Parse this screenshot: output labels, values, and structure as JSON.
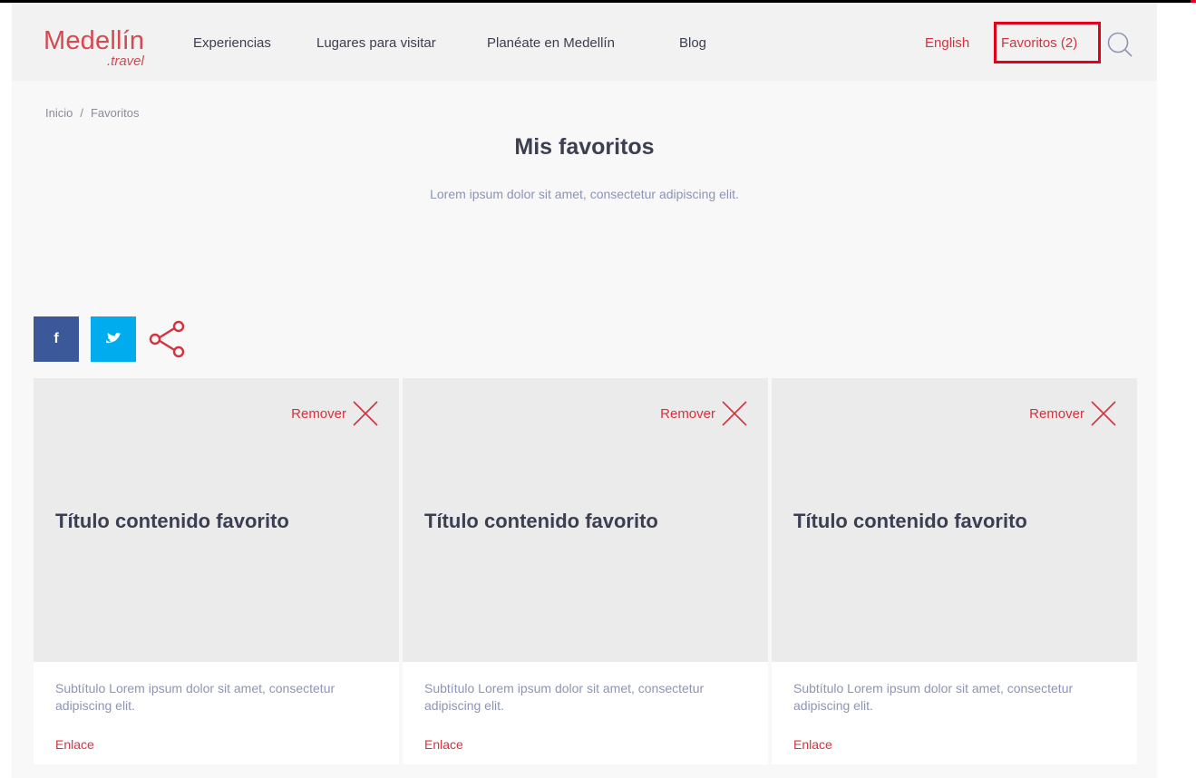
{
  "header": {
    "logo_main": "Medellín",
    "logo_sub": ".travel",
    "nav": [
      "Experiencias",
      "Lugares para visitar",
      "Planéate en Medellín",
      "Blog"
    ],
    "language_label": "English",
    "favorites_label": "Favoritos (2)",
    "search_icon": "search-icon"
  },
  "breadcrumb": {
    "home": "Inicio",
    "separator": "/",
    "current": "Favoritos"
  },
  "page": {
    "title": "Mis favoritos",
    "subtitle": "Lorem ipsum dolor sit amet, consectetur adipiscing elit."
  },
  "social": {
    "facebook_label": "f",
    "icons": [
      "facebook-icon",
      "twitter-icon",
      "share-icon"
    ]
  },
  "cards": [
    {
      "remove_label": "Remover",
      "title": "Título contenido favorito",
      "subtitle": "Subtítulo Lorem ipsum dolor sit amet, consectetur adipiscing elit.",
      "link": "Enlace"
    },
    {
      "remove_label": "Remover",
      "title": "Título contenido favorito",
      "subtitle": "Subtítulo Lorem ipsum dolor sit amet, consectetur adipiscing elit.",
      "link": "Enlace"
    },
    {
      "remove_label": "Remover",
      "title": "Título contenido favorito",
      "subtitle": "Subtítulo Lorem ipsum dolor sit amet, consectetur adipiscing elit.",
      "link": "Enlace"
    }
  ],
  "colors": {
    "accent": "#d4333e",
    "highlight_box": "#e2001a",
    "text_dark": "#3c3e52",
    "text_muted": "#8e94b6",
    "facebook": "#3b5998",
    "twitter": "#00aced"
  }
}
